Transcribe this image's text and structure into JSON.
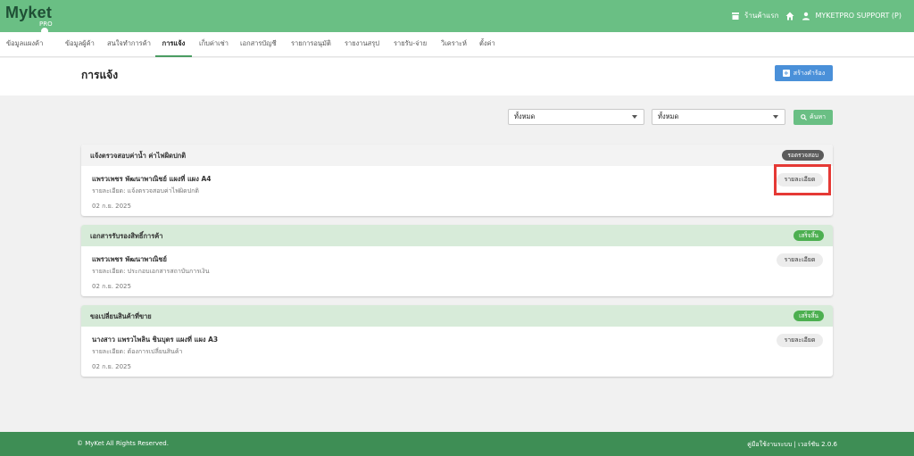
{
  "app": {
    "logo_text": "Myket",
    "logo_sub": "PRO"
  },
  "topbar": {
    "shop_label": "ร้านค้าแรก",
    "user_label": "MYKETPRO SUPPORT (P)"
  },
  "nav": [
    {
      "label": "ข้อมูลแผงค้า"
    },
    {
      "label": "ข้อมูลผู้ค้า"
    },
    {
      "label": "สนใจทำการค้า"
    },
    {
      "label": "การแจ้ง"
    },
    {
      "label": "เก็บค่าเช่า"
    },
    {
      "label": "เอกสารบัญชี"
    },
    {
      "label": "รายการอนุมัติ"
    },
    {
      "label": "รายงานสรุป"
    },
    {
      "label": "รายรับ-จ่าย"
    },
    {
      "label": "วิเคราะห์"
    },
    {
      "label": "ตั้งค่า"
    }
  ],
  "page": {
    "title": "การแจ้ง",
    "create_label": "สร้างคำร้อง"
  },
  "filters": {
    "filter1": "ทั้งหมด",
    "filter2": "ทั้งหมด",
    "search_label": "ค้นหา"
  },
  "cards": [
    {
      "title": "แจ้งตรวจสอบค่าน้ำ ค่าไฟผิดปกติ",
      "status": "รอตรวจสอบ",
      "name": "แพรวเพชร พัฒนาพาณิชย์ แผงที่ แผง A4",
      "detail": "รายละเอียด: แจ้งตรวจสอบค่าไฟผิดปกติ",
      "date": "02 ก.ย. 2025",
      "button": "รายละเอียด"
    },
    {
      "title": "เอกสารรับรองสิทธิ์การค้า",
      "status": "เสร็จสิ้น",
      "name": "แพรวเพชร พัฒนาพาณิชย์",
      "detail": "รายละเอียด: ประกอบเอกสารสถาบันการเงิน",
      "date": "02 ก.ย. 2025",
      "button": "รายละเอียด"
    },
    {
      "title": "ขอเปลี่ยนสินค้าที่ขาย",
      "status": "เสร็จสิ้น",
      "name": "นางสาว แพรวไพลิน ชินบุตร แผงที่ แผง A3",
      "detail": "รายละเอียด: ต้องการเปลี่ยนสินค้า",
      "date": "02 ก.ย. 2025",
      "button": "รายละเอียด"
    }
  ],
  "footer": {
    "copyright": "© MyKet All Rights Reserved.",
    "right": "คู่มือใช้งานระบบ | เวอร์ชัน 2.0.6"
  },
  "colors": {
    "primary": "#6abf84",
    "footer": "#3e8e55",
    "button_blue": "#4a90d9",
    "highlight": "#e53935"
  },
  "icons": [
    "store-icon",
    "home-icon",
    "user-icon",
    "plus-icon",
    "search-icon",
    "chevron-down-icon"
  ]
}
